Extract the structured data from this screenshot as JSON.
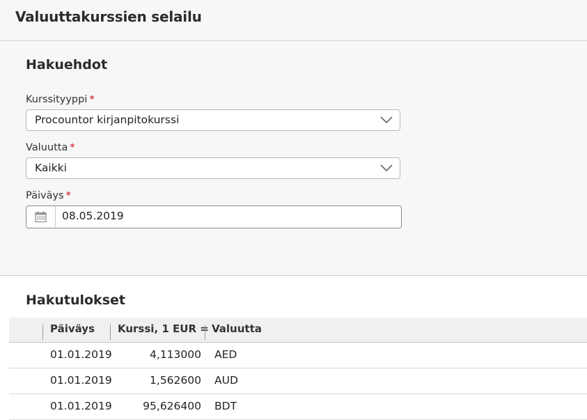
{
  "page": {
    "title": "Valuuttakurssien selailu"
  },
  "search": {
    "title": "Hakuehdot",
    "rate_type": {
      "label": "Kurssityyppi",
      "required_mark": "*",
      "value": "Procountor kirjanpitokurssi"
    },
    "currency": {
      "label": "Valuutta",
      "required_mark": "*",
      "value": "Kaikki"
    },
    "date": {
      "label": "Päiväys",
      "required_mark": "*",
      "value": "08.05.2019"
    }
  },
  "results": {
    "title": "Hakutulokset",
    "columns": [
      "Päiväys",
      "Kurssi, 1 EUR =",
      "Valuutta"
    ],
    "rows": [
      {
        "date": "01.01.2019",
        "rate": "4,113000",
        "currency": "AED"
      },
      {
        "date": "01.01.2019",
        "rate": "1,562600",
        "currency": "AUD"
      },
      {
        "date": "01.01.2019",
        "rate": "95,626400",
        "currency": "BDT"
      }
    ]
  },
  "icons": {
    "chevron": "chevron-down-icon",
    "calendar": "calendar-icon"
  }
}
